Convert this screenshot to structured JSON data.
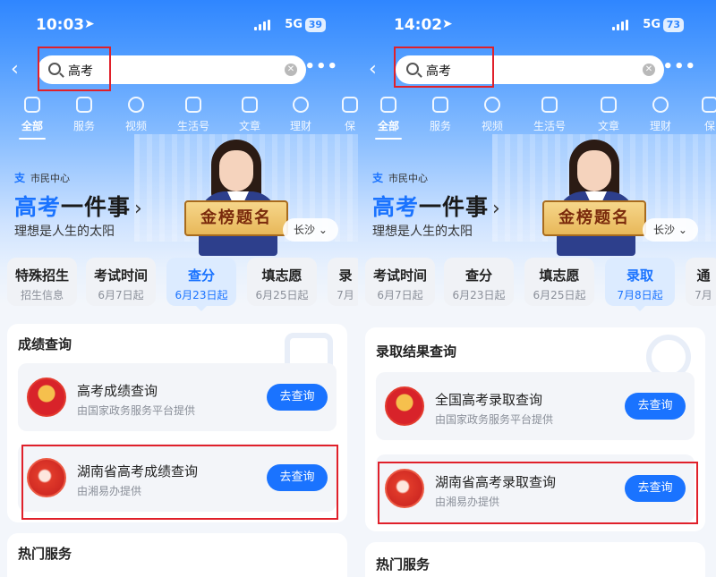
{
  "colors": {
    "accent": "#1a73ff",
    "highlight_box": "#e0202a"
  },
  "left": {
    "status": {
      "time": "10:03",
      "network": "5G",
      "battery": "39"
    },
    "search": {
      "value": "高考"
    },
    "categories": [
      "全部",
      "服务",
      "视频",
      "生活号",
      "文章",
      "理财",
      "保"
    ],
    "hero": {
      "org": "市民中心",
      "title_highlight": "高考",
      "title_rest": "一件事",
      "subtitle": "理想是人生的太阳",
      "city": "长沙",
      "scroll_text": "金榜题名"
    },
    "tabs": [
      {
        "title": "特殊招生",
        "sub": "招生信息"
      },
      {
        "title": "考试时间",
        "sub": "6月7日起"
      },
      {
        "title": "查分",
        "sub": "6月23日起"
      },
      {
        "title": "填志愿",
        "sub": "6月25日起"
      },
      {
        "title": "录",
        "sub": "7月"
      }
    ],
    "section_title": "成绩查询",
    "items": [
      {
        "name": "高考成绩查询",
        "provider": "由国家政务服务平台提供",
        "button": "去查询"
      },
      {
        "name": "湖南省高考成绩查询",
        "provider": "由湘易办提供",
        "button": "去查询"
      }
    ],
    "hot_title": "热门服务"
  },
  "right": {
    "status": {
      "time": "14:02",
      "network": "5G",
      "battery": "73"
    },
    "search": {
      "value": "高考"
    },
    "categories": [
      "全部",
      "服务",
      "视频",
      "生活号",
      "文章",
      "理财",
      "保"
    ],
    "hero": {
      "org": "市民中心",
      "title_highlight": "高考",
      "title_rest": "一件事",
      "subtitle": "理想是人生的太阳",
      "city": "长沙",
      "scroll_text": "金榜题名"
    },
    "tabs": [
      {
        "title": "考试时间",
        "sub": "6月7日起"
      },
      {
        "title": "查分",
        "sub": "6月23日起"
      },
      {
        "title": "填志愿",
        "sub": "6月25日起"
      },
      {
        "title": "录取",
        "sub": "7月8日起"
      },
      {
        "title": "通",
        "sub": "7月"
      }
    ],
    "section_title": "录取结果查询",
    "items": [
      {
        "name": "全国高考录取查询",
        "provider": "由国家政务服务平台提供",
        "button": "去查询"
      },
      {
        "name": "湖南省高考录取查询",
        "provider": "由湘易办提供",
        "button": "去查询"
      }
    ],
    "hot_title": "热门服务"
  }
}
